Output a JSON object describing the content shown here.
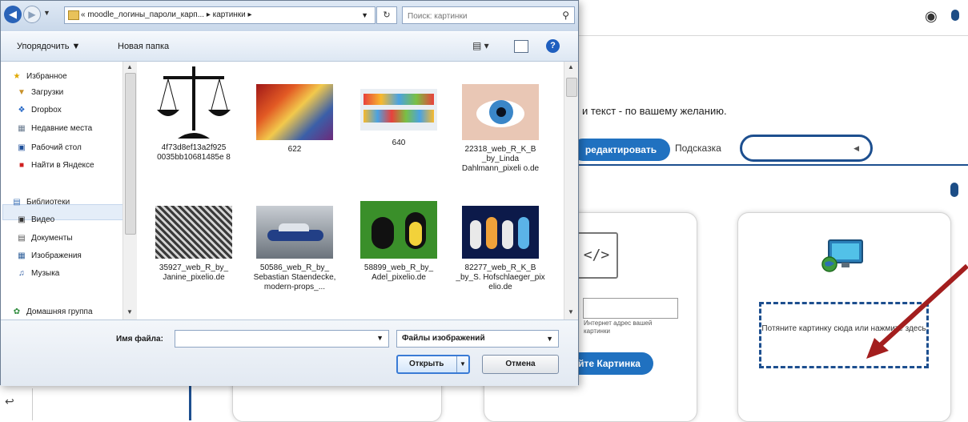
{
  "background_page": {
    "intro_text": "и текст - по вашему желанию.",
    "edit_button": "редактировать",
    "hint_label": "Подсказка",
    "hint_value": "",
    "url_help": "Интернет адрес вашей картинки",
    "picture_button": "йте Картинка",
    "drop_zone_text": "Потяните картинку сюда или нажмите здесь",
    "code_icon": "</>",
    "camera_icon": "camera-icon"
  },
  "dialog": {
    "back_icon": "back-arrow-icon",
    "forward_icon": "forward-arrow-icon",
    "address_path": "«  moodle_логины_пароли_карп...  ▸  картинки  ▸",
    "search_placeholder": "Поиск: картинки",
    "toolbar": {
      "organize": "Упорядочить ▼",
      "new_folder": "Новая папка"
    },
    "nav": {
      "favorites_header": "Избранное",
      "favorites": [
        {
          "label": "Загрузки",
          "icon": "downloads-icon"
        },
        {
          "label": "Dropbox",
          "icon": "dropbox-icon"
        },
        {
          "label": "Недавние места",
          "icon": "recent-places-icon"
        },
        {
          "label": "Рабочий стол",
          "icon": "desktop-icon"
        },
        {
          "label": "Найти в Яндексе",
          "icon": "yandex-icon"
        }
      ],
      "libraries_header": "Библиотеки",
      "libraries": [
        {
          "label": "Видео",
          "icon": "video-icon"
        },
        {
          "label": "Документы",
          "icon": "documents-icon"
        },
        {
          "label": "Изображения",
          "icon": "images-icon"
        },
        {
          "label": "Музыка",
          "icon": "music-icon"
        }
      ],
      "homegroup": "Домашняя группа"
    },
    "files": [
      {
        "name": "4f73d8ef13a2f925 0035bb10681485e 8"
      },
      {
        "name": "622"
      },
      {
        "name": "640"
      },
      {
        "name": "22318_web_R_K_B _by_Linda Dahlmann_pixeli o.de"
      },
      {
        "name": "35927_web_R_by_ Janine_pixelio.de"
      },
      {
        "name": "50586_web_R_by_ Sebastian Staendecke, modern-props_..."
      },
      {
        "name": "58899_web_R_by_ Adel_pixelio.de"
      },
      {
        "name": "82277_web_R_K_B _by_S. Hofschlaeger_pix elio.de"
      }
    ],
    "filename_label": "Имя файла:",
    "filename_value": "",
    "filetype_value": "Файлы изображений",
    "open_button": "Открыть",
    "cancel_button": "Отмена"
  }
}
